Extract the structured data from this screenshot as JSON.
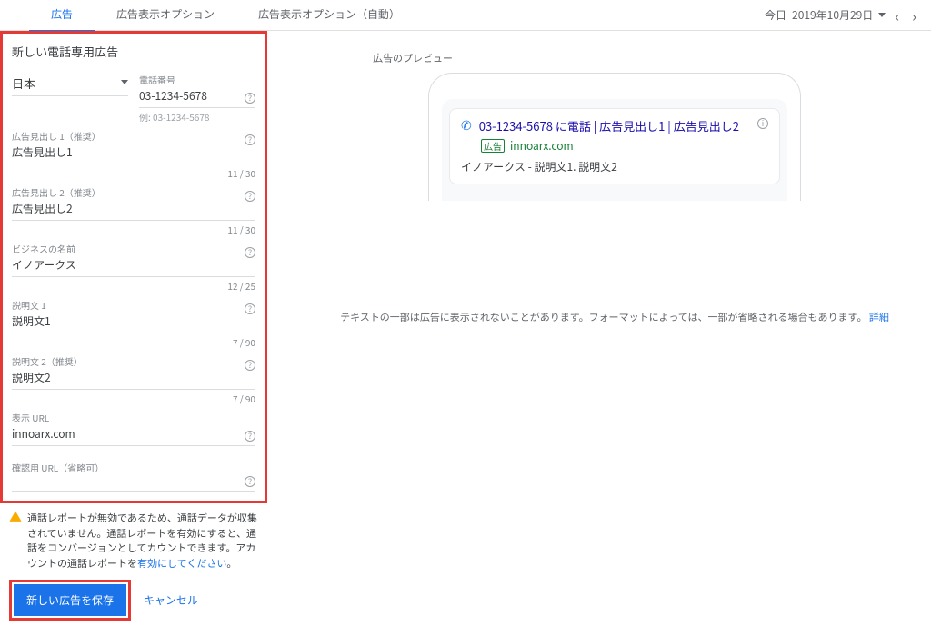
{
  "tabs": {
    "ad": "広告",
    "ext": "広告表示オプション",
    "ext_auto": "広告表示オプション（自動）"
  },
  "date_range": {
    "label": "今日",
    "value": "2019年10月29日"
  },
  "form": {
    "title": "新しい電話専用広告",
    "country": {
      "label": "",
      "value": "日本"
    },
    "phone": {
      "label": "電話番号",
      "value": "03-1234-5678",
      "hint": "例: 03-1234-5678"
    },
    "headline1": {
      "label": "広告見出し 1（推奨）",
      "value": "広告見出し1",
      "count": "11 / 30"
    },
    "headline2": {
      "label": "広告見出し 2（推奨）",
      "value": "広告見出し2",
      "count": "11 / 30"
    },
    "business": {
      "label": "ビジネスの名前",
      "value": "イノアークス",
      "count": "12 / 25"
    },
    "desc1": {
      "label": "説明文 1",
      "value": "説明文1",
      "count": "7 / 90"
    },
    "desc2": {
      "label": "説明文 2（推奨）",
      "value": "説明文2",
      "count": "7 / 90"
    },
    "display_url": {
      "label": "表示 URL",
      "value": "innoarx.com"
    },
    "verify_url": {
      "label": "確認用 URL（省略可）",
      "value": ""
    }
  },
  "warn": {
    "text1": "通話レポートが無効であるため、通話データが収集されていません。通話レポートを有効にすると、通話をコンバージョンとしてカウントできます。アカウントの通話レポートを",
    "link": "有効にしてください",
    "text2": "。"
  },
  "actions": {
    "save": "新しい広告を保存",
    "cancel": "キャンセル"
  },
  "preview": {
    "label": "広告のプレビュー",
    "headline": "03-1234-5678 に電話 | 広告見出し1 | 広告見出し2",
    "badge": "広告",
    "url": "innoarx.com",
    "desc": "イノアークス - 説明文1. 説明文2"
  },
  "footnote": {
    "text": "テキストの一部は広告に表示されないことがあります。フォーマットによっては、一部が省略される場合もあります。",
    "link": "詳細"
  }
}
